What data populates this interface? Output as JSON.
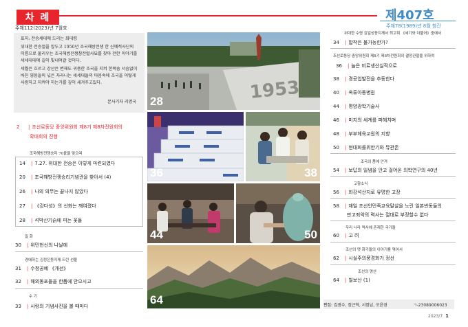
{
  "header": {
    "category": "차 례",
    "left_sub": "주체112(2023)년 7월호",
    "issue": "제407호",
    "issue_sub": "주체78(1989)년 8월 창간"
  },
  "intro": {
    "heading": "표지: 전승세대에 드리는 최대령",
    "paragraphs": [
      "위대한 전승절을 앞두고 1950년 조국해방전쟁 한 신예적사단의 이름으로 불리우는 조국해방전쟁참전렬사묘를 찾아 전한 이야기를 세세대대에 길이 빛내여갈 것이다.",
      "세월은 흐르고 강산은 변해도 귀중한 조국을 지켜 한목숨 서슴없이 바친 영웅들의 넋은 자라나는 세세대들의 마음속에 조국을 어떻게 사랑하고 지켜야 하는가를 깊이 새겨주고있다."
    ],
    "signature": "본사기자 리명국"
  },
  "left_toc": {
    "lead": {
      "num": "2",
      "title_1": "조선로동당 중앙위원회 제8기 제8차전원회의",
      "title_2": "확대회의 진행"
    },
    "section_1": "조국해방전쟁승리 70돐을 맞으며",
    "items_1": [
      {
        "num": "14",
        "title": "7.27. 위대한 전승은 이렇게 마련되였다"
      },
      {
        "num": "20",
        "title": "조국해방전쟁승리기념관을 찾아서 (4)"
      },
      {
        "num": "26",
        "title": "나의 의무는 끝나지 않았다"
      },
      {
        "num": "27",
        "title": "《강다성》의 신화는 깨여졌다"
      },
      {
        "num": "28",
        "title": "석박산기슭에 피는 꽃들"
      }
    ],
    "section_2": "일 화",
    "item_2": {
      "num": "30",
      "title": "위민헌신의 나날에"
    },
    "section_3": "경애하는 김정은동지께 드린 선물",
    "items_3": [
      {
        "num": "31",
        "title": "수정공예 《개선》"
      },
      {
        "num": "32",
        "title": "해외동포들을 한품에 안으시고"
      }
    ],
    "section_4": "수 기",
    "item_4": {
      "num": "33",
      "title": "사랑의 기념사진을 볼 때마다"
    }
  },
  "photos": [
    {
      "label": "28"
    },
    {
      "label": "36"
    },
    {
      "label": "38"
    },
    {
      "label": "44"
    },
    {
      "label": "50"
    },
    {
      "label": "64"
    }
  ],
  "right_toc": {
    "section_1": "위대한 수령 김일성동지께서 최고휘 《세기와 더불어》중에서",
    "items_1": [
      {
        "num": "34",
        "title": "합작은 불가능한가?"
      }
    ],
    "section_2": "조선로동당 중앙위원회 제8기 제8차전원회의 결정관철을 위하여",
    "items_2": [
      {
        "num": "36",
        "title": "늘은 비료생산실적으로"
      },
      {
        "num": "38",
        "title": "경공업발전을 추동한다"
      },
      {
        "num": "40",
        "title": "옥류아동병원"
      },
      {
        "num": "44",
        "title": "평양광학기술사"
      },
      {
        "num": "46",
        "title": "미지의 세계를 파헤치며"
      },
      {
        "num": "48",
        "title": "부부체육교원의 지향"
      },
      {
        "num": "50",
        "title": "현대화를위한기와 뮤관존"
      }
    ],
    "section_3": "조국의 품에 안겨",
    "items_3": [
      {
        "num": "54",
        "title": "보답의 일념을 안고 걸어온 의학연구의 40년"
      }
    ],
    "section_4": "고향소식",
    "items_4": [
      {
        "num": "56",
        "title": "화강석산지로 유명한 고장"
      }
    ],
    "items_5": [
      {
        "num": "58",
        "title_1": "재일 조선인민족교육말살을 노린 일본반동들의",
        "title_2": "만고죄악의 력사는 절대로 부정할수 없다"
      }
    ],
    "section_6": "우리 나라 력사에 존재한 국가들",
    "items_6": [
      {
        "num": "60",
        "title": "고 려"
      }
    ],
    "section_7": "조선의 옛 화가들의 이야기를 엮어서",
    "items_7": [
      {
        "num": "62",
        "title": "시실주의풍경화가 정선"
      }
    ],
    "section_8": "조선의 명산",
    "items_8": [
      {
        "num": "64",
        "title": "칠보산 (1)"
      }
    ]
  },
  "footer": {
    "credit": "편집: 김광수, 정근혁, 서정남, 오윤경",
    "code": "ㄱ-23089006023",
    "page_label": "2023/7",
    "page_num": "1"
  },
  "colors": {
    "accent_red": "#e8242c",
    "accent_blue": "#3f8bc7"
  }
}
